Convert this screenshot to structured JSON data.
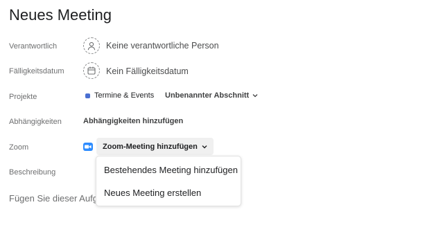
{
  "task": {
    "title": "Neues Meeting"
  },
  "fields": {
    "assignee": {
      "label": "Verantwortlich",
      "value": "Keine verantwortliche Person"
    },
    "due_date": {
      "label": "Fälligkeitsdatum",
      "value": "Kein Fälligkeitsdatum"
    },
    "projects": {
      "label": "Projekte",
      "project_name": "Termine & Events",
      "project_color": "#4a6fd1",
      "section_name": "Unbenannter Abschnitt"
    },
    "dependencies": {
      "label": "Abhängigkeiten",
      "action": "Abhängigkeiten hinzufügen"
    },
    "zoom": {
      "label": "Zoom",
      "button": "Zoom-Meeting hinzufügen",
      "icon": "zoom-video-icon",
      "icon_color": "#2d8cff"
    },
    "description": {
      "label": "Beschreibung",
      "placeholder_visible": "Fügen Sie dieser Aufga"
    }
  },
  "zoom_menu": {
    "items": [
      "Bestehendes Meeting hinzufügen",
      "Neues Meeting erstellen"
    ]
  }
}
